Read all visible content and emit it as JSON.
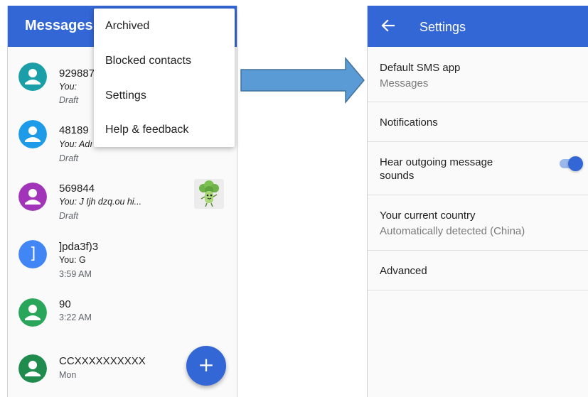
{
  "left": {
    "appbar_title": "Messages",
    "menu": [
      "Archived",
      "Blocked contacts",
      "Settings",
      "Help & feedback"
    ],
    "conversations": [
      {
        "name": "929887",
        "snippet": "You:",
        "meta": "Draft",
        "avatar_color": "#1a9fa8"
      },
      {
        "name": "48189",
        "snippet": "You: Adı",
        "meta": "Draft",
        "avatar_color": "#1e9be8"
      },
      {
        "name": "569844",
        "snippet": "You: J Ijh dzq.ou hi...",
        "meta": "Draft",
        "avatar_color": "#a134b8"
      },
      {
        "name": "]pda3f)3",
        "snippet": "You: G",
        "meta": "3:59 AM",
        "avatar_color": "#4285f4",
        "avatar_glyph": "]"
      },
      {
        "name": "90",
        "snippet": "",
        "meta": "3:22 AM",
        "avatar_color": "#2aa65a"
      },
      {
        "name": "CCXXXXXXXXXX",
        "snippet": "",
        "meta": "Mon",
        "avatar_color": "#1f8c4e"
      }
    ],
    "fab_label": "+"
  },
  "right": {
    "appbar_title": "Settings",
    "prefs": [
      {
        "title": "Default SMS app",
        "subtitle": "Messages"
      },
      {
        "title": "Notifications"
      },
      {
        "title_line1": "Hear outgoing message",
        "title_line2": "sounds",
        "toggle_on": true
      },
      {
        "title": "Your current country",
        "subtitle": "Automatically detected (China)"
      },
      {
        "title": "Advanced"
      }
    ]
  },
  "colors": {
    "primary": "#3367d6",
    "arrow_fill": "#5b9bd5",
    "arrow_stroke": "#41719c"
  }
}
